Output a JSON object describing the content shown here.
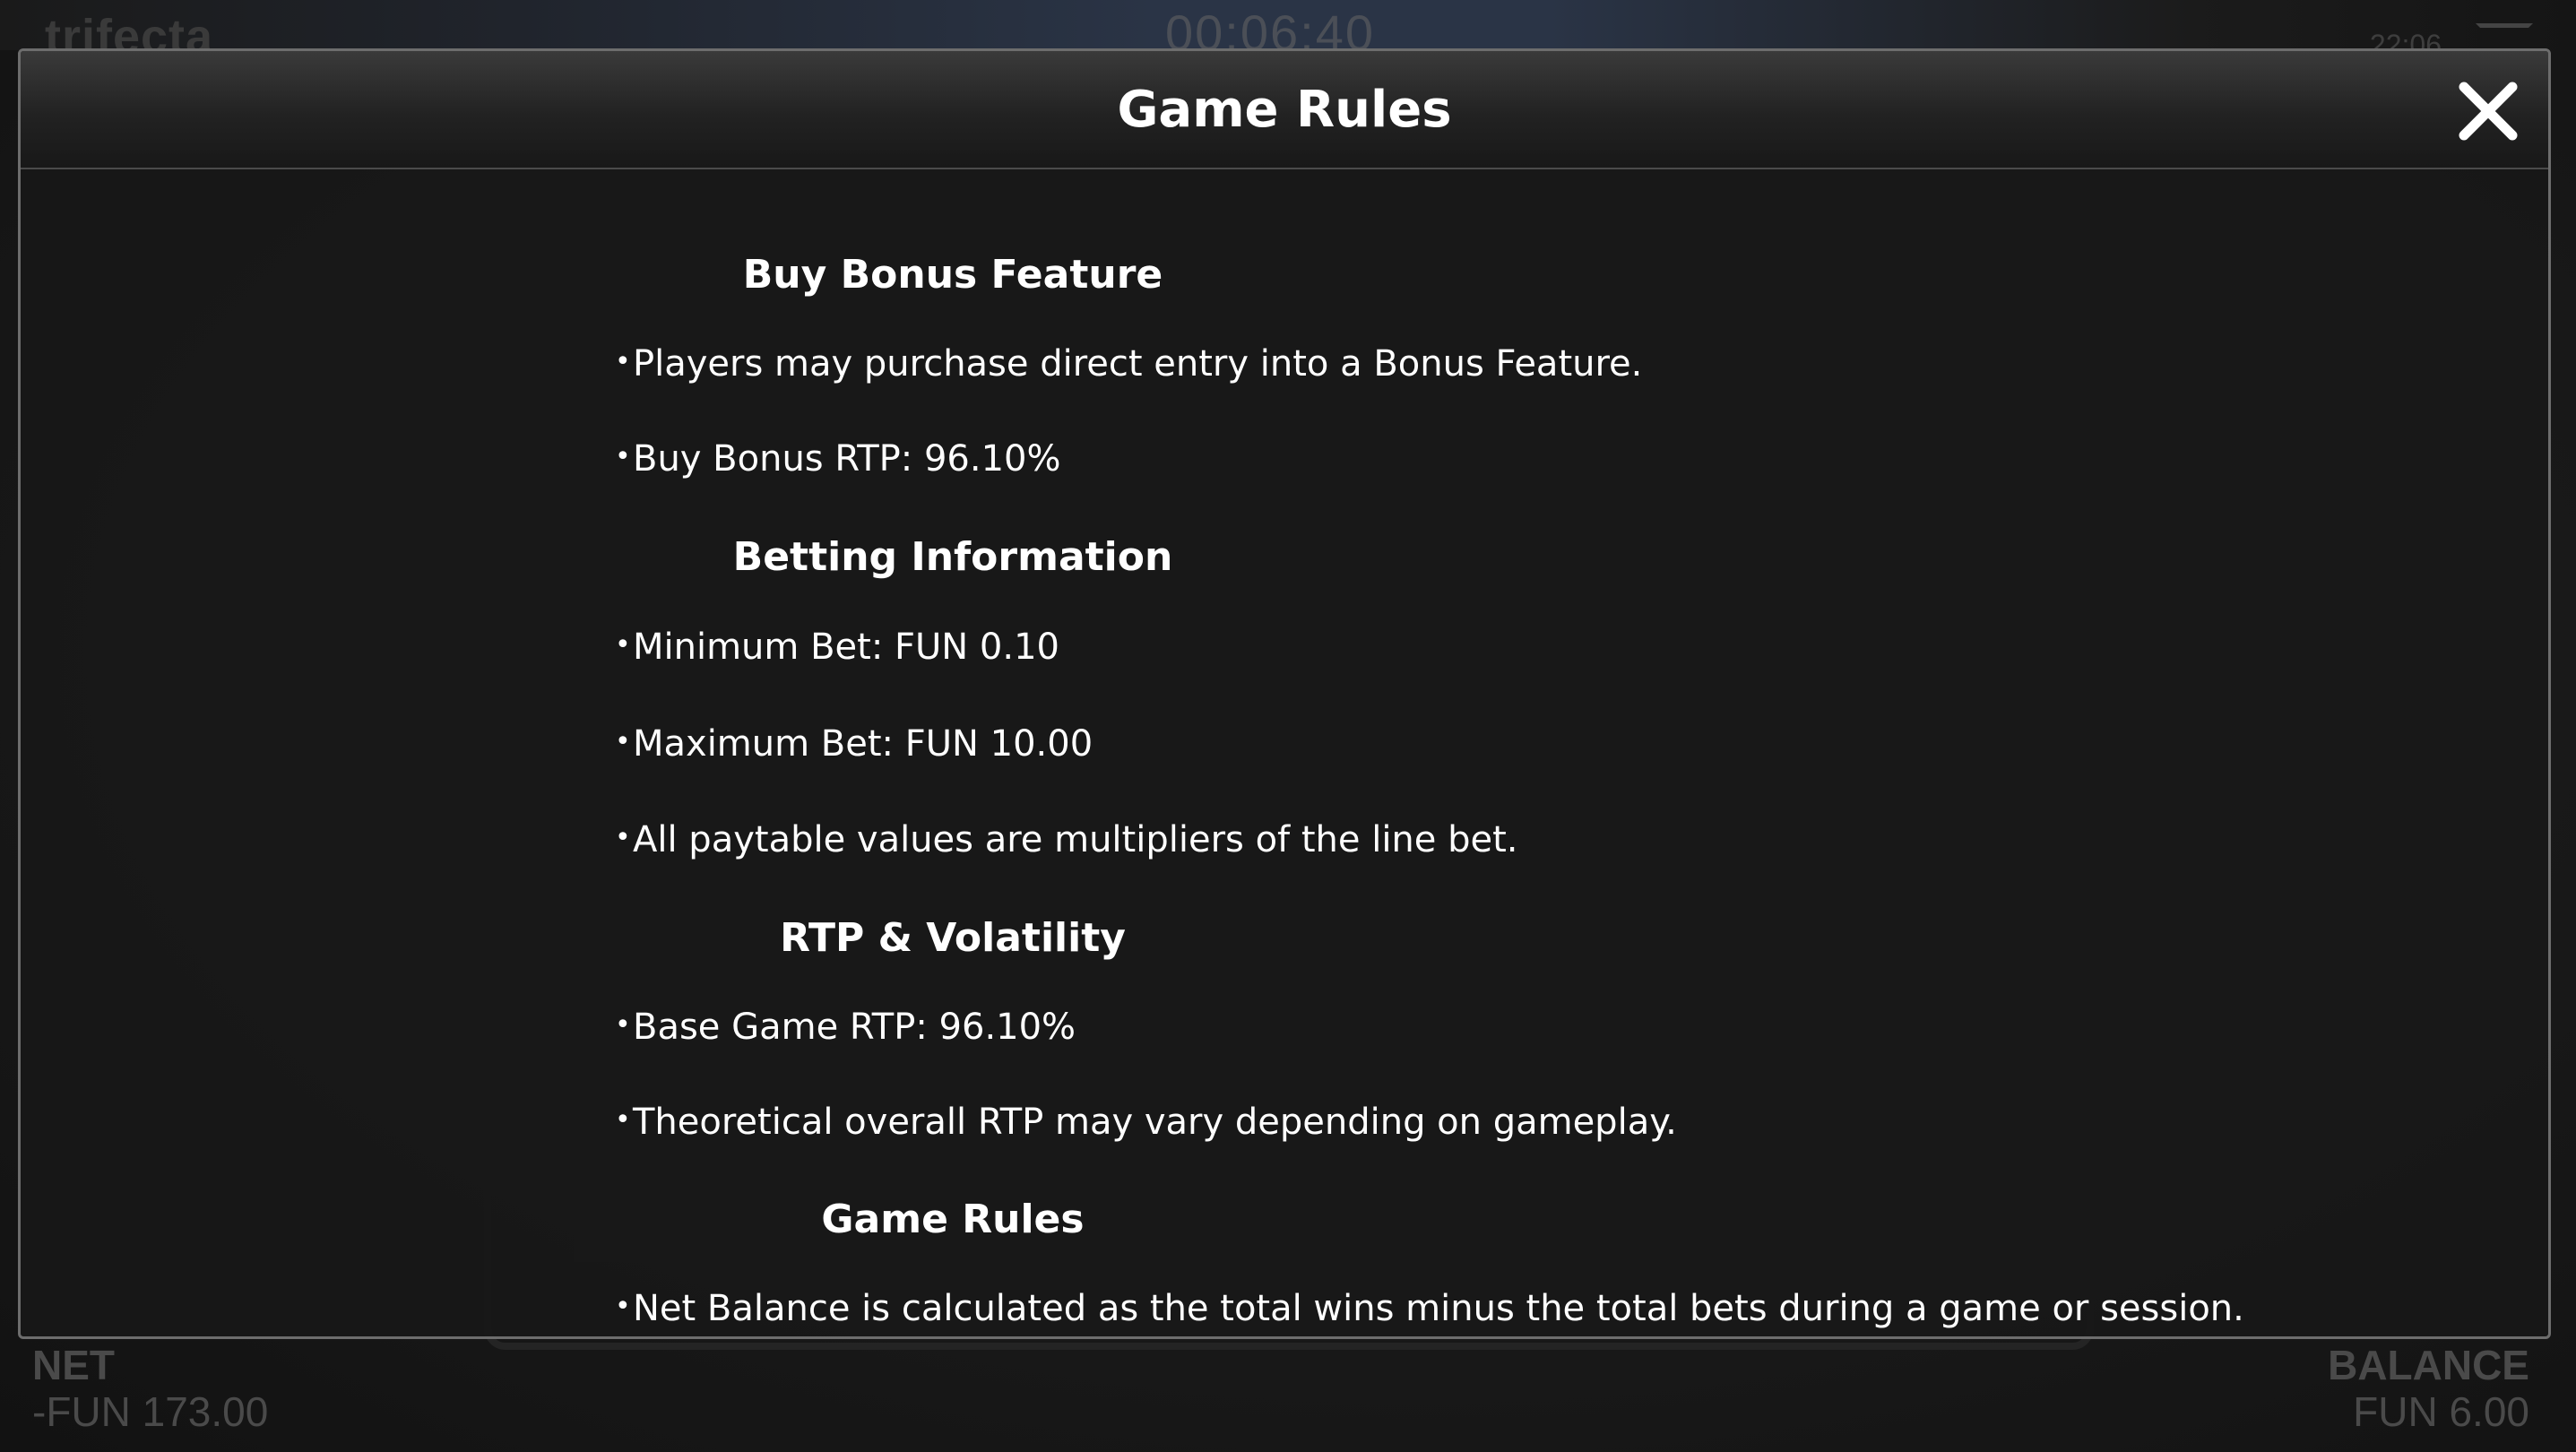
{
  "background": {
    "logo_text": "trifecta",
    "timer": "00:06:40",
    "clock": "22:06"
  },
  "modal": {
    "title": "Game Rules",
    "close_icon": "close-icon",
    "sections": [
      {
        "heading": "Buy Bonus Feature",
        "items": [
          "Players may purchase direct entry into a Bonus Feature.",
          "Buy Bonus RTP: 96.10%"
        ]
      },
      {
        "heading": "Betting Information",
        "items": [
          "Minimum Bet: FUN 0.10",
          "Maximum Bet: FUN 10.00",
          "All paytable values are multipliers of the line bet."
        ]
      },
      {
        "heading": "RTP & Volatility",
        "items": [
          "Base Game RTP: 96.10%",
          "Theoretical overall RTP may vary depending on gameplay."
        ]
      },
      {
        "heading": "Game Rules",
        "items": [
          "Net Balance is calculated as the total wins minus the total bets during a game or session."
        ]
      }
    ]
  },
  "footer": {
    "net_label": "NET",
    "net_value": "-FUN 173.00",
    "balance_label": "BALANCE",
    "balance_value": "FUN 6.00"
  }
}
